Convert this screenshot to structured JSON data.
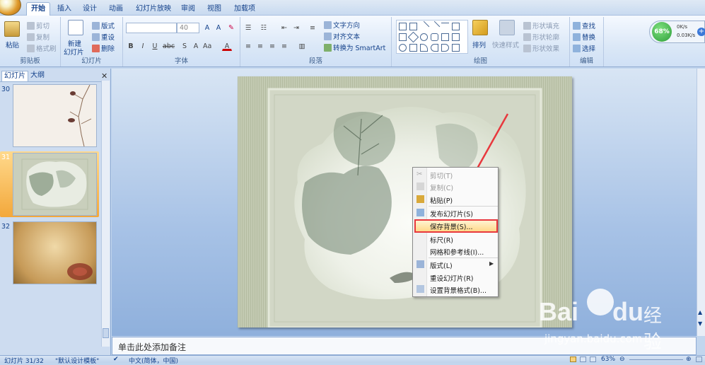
{
  "tabs": [
    "开始",
    "插入",
    "设计",
    "动画",
    "幻灯片放映",
    "审阅",
    "视图",
    "加载项"
  ],
  "ribbon": {
    "clipboard": {
      "paste": "粘贴",
      "cut": "剪切",
      "copy": "复制",
      "format_painter": "格式刷",
      "label": "剪贴板"
    },
    "slides": {
      "new_slide": "新建",
      "new_slide2": "幻灯片",
      "layout": "版式",
      "reset": "重设",
      "delete": "删除",
      "label": "幻灯片"
    },
    "font": {
      "size": "40",
      "label": "字体"
    },
    "paragraph": {
      "text_direction": "文字方向",
      "align_text": "对齐文本",
      "smartart": "转换为 SmartArt",
      "label": "段落"
    },
    "drawing": {
      "arrange": "排列",
      "quick_styles": "快速样式",
      "shape_fill": "形状填充",
      "shape_outline": "形状轮廓",
      "shape_effects": "形状效果",
      "label": "绘图"
    },
    "editing": {
      "find": "查找",
      "replace": "替换",
      "select": "选择",
      "label": "编辑"
    }
  },
  "net_widget": {
    "percent": "68%",
    "up": "0K/s",
    "down": "0.03K/s"
  },
  "left_pane": {
    "tab_slides": "幻灯片",
    "tab_outline": "大纲",
    "slides": [
      {
        "num": "30"
      },
      {
        "num": "31"
      },
      {
        "num": "32"
      }
    ]
  },
  "context_menu": [
    {
      "label": "剪切(T)",
      "disabled": true
    },
    {
      "label": "复制(C)",
      "disabled": true
    },
    {
      "label": "粘贴(P)",
      "disabled": false
    },
    {
      "label": "发布幻灯片(S)",
      "disabled": false
    },
    {
      "label": "保存背景(S)...",
      "disabled": false,
      "highlighted": true
    },
    {
      "label": "标尺(R)",
      "disabled": false
    },
    {
      "label": "网格和参考线(I)...",
      "disabled": false
    },
    {
      "label": "版式(L)",
      "disabled": false
    },
    {
      "label": "重设幻灯片(R)",
      "disabled": false
    },
    {
      "label": "设置背景格式(B)...",
      "disabled": false
    }
  ],
  "notes_placeholder": "单击此处添加备注",
  "status": {
    "slide_info": "幻灯片 31/32",
    "theme": "\"默认设计模板\"",
    "language": "中文(简体，中国)",
    "zoom": "63%"
  },
  "watermark": {
    "brand": "Bai",
    "brand2": "du",
    "suffix": "经验",
    "url": "jingyan.baidu.com"
  },
  "colors": {
    "highlight": "#e8383d",
    "accent_blue": "#15428b",
    "ribbon": "#dbe8f7"
  }
}
